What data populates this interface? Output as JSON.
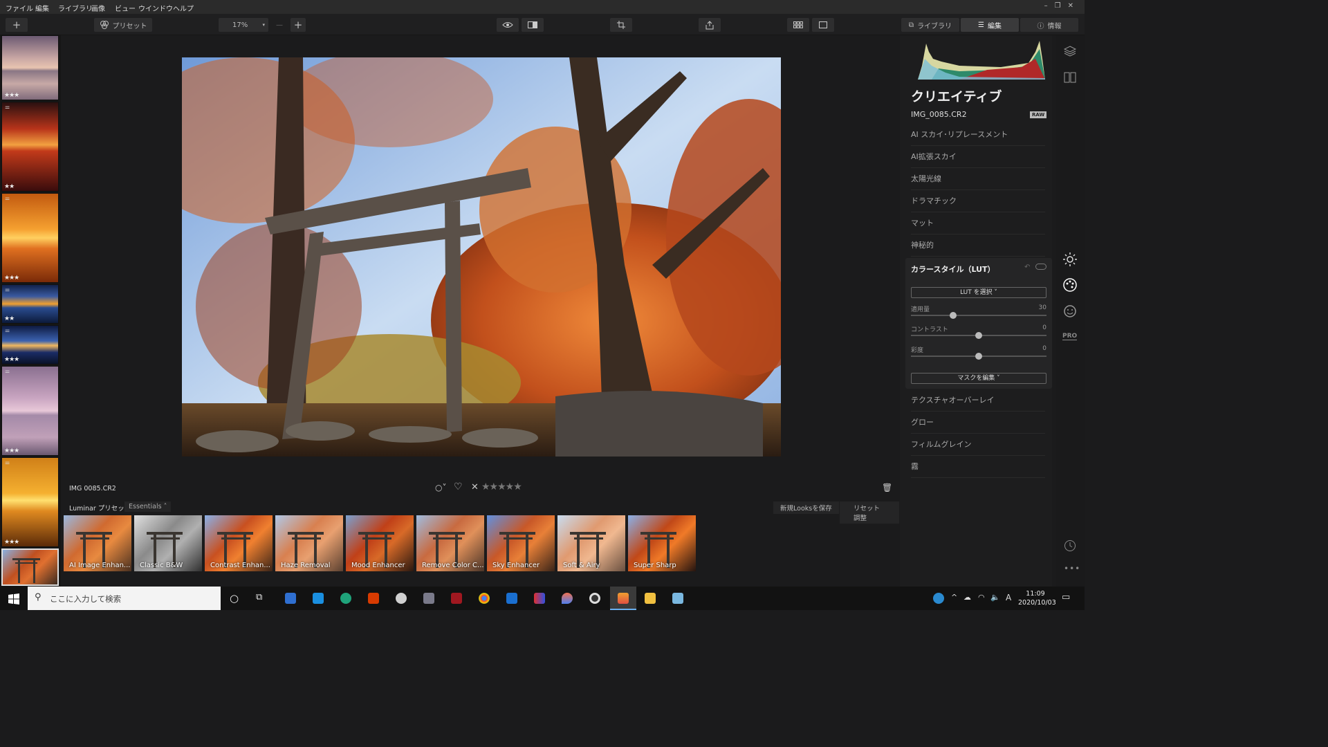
{
  "menu": [
    "ファイル",
    "編集",
    "ライブラリ",
    "画像",
    "ビュー",
    "ウインドウ",
    "ヘルプ"
  ],
  "toolbar": {
    "add_label": "+",
    "preset_label": "プリセット",
    "zoom_value": "17%",
    "zoom_out": "—",
    "zoom_in": "+",
    "tabs": [
      {
        "label": "ライブラリ",
        "icon": "library-icon"
      },
      {
        "label": "編集",
        "icon": "sliders-icon"
      },
      {
        "label": "情報",
        "icon": "info-icon"
      }
    ]
  },
  "filmstrip": [
    {
      "stars": "★★★",
      "adjusted": false
    },
    {
      "stars": "★★",
      "adjusted": true
    },
    {
      "stars": "★★★",
      "adjusted": true
    },
    {
      "stars": "★★",
      "adjusted": true
    },
    {
      "stars": "★★★",
      "adjusted": true
    },
    {
      "stars": "★★★",
      "adjusted": true
    },
    {
      "stars": "★★★",
      "adjusted": true
    },
    {
      "stars": "",
      "adjusted": false
    }
  ],
  "image": {
    "filename": "IMG 0085.CR2",
    "rating_stars": "★★★★★",
    "reject_symbol": "✕",
    "heart_symbol": "♡"
  },
  "presets": {
    "group_label": "Luminar プリセット",
    "category": "Essentials",
    "save_button": "新規Looksを保存",
    "reset_button": "リセット調整",
    "items": [
      "AI Image Enhan...",
      "Classic B&W",
      "Contrast Enhan...",
      "Haze Removal",
      "Mood Enhancer",
      "Remove Color C...",
      "Sky Enhancer",
      "Soft & Airy",
      "Super Sharp"
    ]
  },
  "panel": {
    "title": "クリエイティブ",
    "filename": "IMG_0085.CR2",
    "raw_badge": "RAW",
    "tools_top": [
      "AI スカイ･リプレースメント",
      "AI拡張スカイ",
      "太陽光線",
      "ドラマチック",
      "マット",
      "神秘的"
    ],
    "lut": {
      "title": "カラースタイル（LUT）",
      "select_button": "LUT を選択 ˅",
      "sliders": [
        {
          "label": "適用量",
          "value": 30,
          "fraction": 0.31
        },
        {
          "label": "コントラスト",
          "value": 0,
          "fraction": 0.5
        },
        {
          "label": "彩度",
          "value": 0,
          "fraction": 0.5
        }
      ],
      "mask_button": "マスクを編集 ˅"
    },
    "tools_bottom": [
      "テクスチャオーバーレイ",
      "グロー",
      "フィルムグレイン",
      "霧"
    ]
  },
  "sidebar_icons": [
    "layers-icon",
    "compare-icon",
    "sun-icon",
    "palette-icon",
    "face-icon",
    "pro-icon",
    "history-icon",
    "more-icon"
  ],
  "sidebar_pro_label": "PRO",
  "taskbar": {
    "search_placeholder": "ここに入力して検索",
    "time": "11:09",
    "date": "2020/10/03",
    "ime": "A"
  },
  "colors": {
    "accent": "#f0a030",
    "panel_bg": "#1d1d1e",
    "app_bg": "#1b1b1c"
  }
}
